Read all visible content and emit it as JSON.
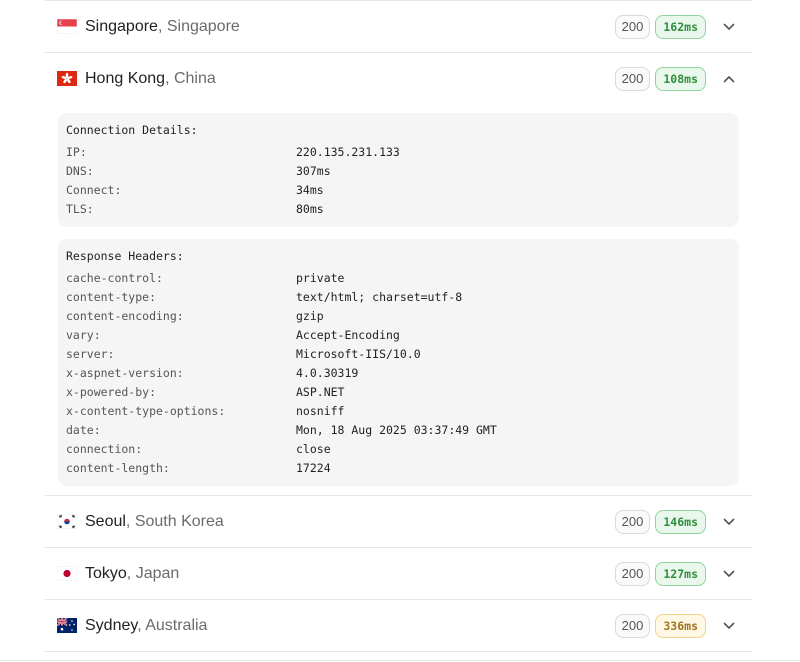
{
  "locations": [
    {
      "city": "Singapore",
      "country": ", Singapore",
      "status": "200",
      "ms": "162ms",
      "ms_level": "green",
      "flag": "sg-flag-icon",
      "expanded": false
    },
    {
      "city": "Hong Kong",
      "country": ", China",
      "status": "200",
      "ms": "108ms",
      "ms_level": "green",
      "flag": "hk-flag-icon",
      "expanded": true
    },
    {
      "city": "Seoul",
      "country": ", South Korea",
      "status": "200",
      "ms": "146ms",
      "ms_level": "green",
      "flag": "kr-flag-icon",
      "expanded": false
    },
    {
      "city": "Tokyo",
      "country": ", Japan",
      "status": "200",
      "ms": "127ms",
      "ms_level": "green",
      "flag": "jp-flag-icon",
      "expanded": false
    },
    {
      "city": "Sydney",
      "country": ", Australia",
      "status": "200",
      "ms": "336ms",
      "ms_level": "yellow",
      "flag": "au-flag-icon",
      "expanded": false
    }
  ],
  "connection": {
    "title": "Connection Details:",
    "items": [
      {
        "k": "IP:",
        "v": "220.135.231.133"
      },
      {
        "k": "DNS:",
        "v": "307ms"
      },
      {
        "k": "Connect:",
        "v": "34ms"
      },
      {
        "k": "TLS:",
        "v": "80ms"
      }
    ]
  },
  "headers": {
    "title": "Response Headers:",
    "items": [
      {
        "k": "cache-control:",
        "v": "private"
      },
      {
        "k": "content-type:",
        "v": "text/html; charset=utf-8"
      },
      {
        "k": "content-encoding:",
        "v": "gzip"
      },
      {
        "k": "vary:",
        "v": "Accept-Encoding"
      },
      {
        "k": "server:",
        "v": "Microsoft-IIS/10.0"
      },
      {
        "k": "x-aspnet-version:",
        "v": "4.0.30319"
      },
      {
        "k": "x-powered-by:",
        "v": "ASP.NET"
      },
      {
        "k": "x-content-type-options:",
        "v": "nosniff"
      },
      {
        "k": "date:",
        "v": "Mon, 18 Aug 2025 03:37:49 GMT"
      },
      {
        "k": "connection:",
        "v": "close"
      },
      {
        "k": "content-length:",
        "v": "17224"
      }
    ]
  },
  "colors": {
    "green_text": "#2f8f3c",
    "yellow_text": "#a1741e",
    "divider": "#e6e6e6"
  }
}
